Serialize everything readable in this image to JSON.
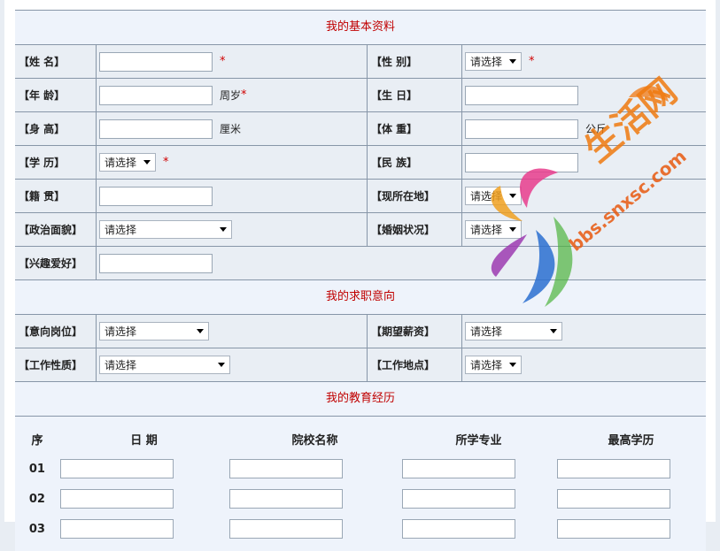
{
  "sections": {
    "basic": "我的基本资料",
    "intent": "我的求职意向",
    "education": "我的教育经历"
  },
  "labels": {
    "name": "【姓  名】",
    "gender": "【性  别】",
    "age": "【年  龄】",
    "birthday": "【生  日】",
    "height": "【身  高】",
    "weight": "【体  重】",
    "degree": "【学  历】",
    "ethnicity": "【民  族】",
    "hometown": "【籍  贯】",
    "location": "【现所在地】",
    "political": "【政治面貌】",
    "marital": "【婚姻状况】",
    "hobbies": "【兴趣爱好】",
    "position": "【意向岗位】",
    "salary": "【期望薪资】",
    "job_type": "【工作性质】",
    "work_place": "【工作地点】"
  },
  "units": {
    "age": "周岁",
    "height": "厘米",
    "weight": "公斤"
  },
  "required_mark": "*",
  "select_placeholder": "请选择",
  "education_table": {
    "headers": [
      "序",
      "日  期",
      "院校名称",
      "所学专业",
      "最高学历"
    ],
    "rows": [
      "01",
      "02",
      "03"
    ]
  },
  "watermark": {
    "line1": "生活网",
    "line2": "bbs.snxsc.com"
  }
}
